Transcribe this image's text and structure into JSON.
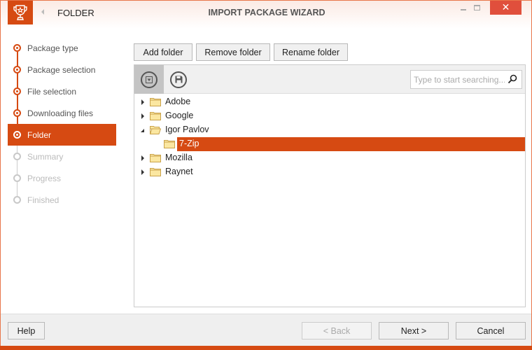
{
  "window": {
    "title": "IMPORT PACKAGE WIZARD",
    "page_title": "FOLDER",
    "accent_color": "#d64a12",
    "close_label": "✕"
  },
  "steps": [
    {
      "label": "Package type",
      "state": "done"
    },
    {
      "label": "Package selection",
      "state": "done"
    },
    {
      "label": "File selection",
      "state": "done"
    },
    {
      "label": "Downloading files",
      "state": "done"
    },
    {
      "label": "Folder",
      "state": "active"
    },
    {
      "label": "Summary",
      "state": "todo"
    },
    {
      "label": "Progress",
      "state": "todo"
    },
    {
      "label": "Finished",
      "state": "todo"
    }
  ],
  "actions": {
    "add_folder": "Add folder",
    "remove_folder": "Remove folder",
    "rename_folder": "Rename folder"
  },
  "toolbar": {
    "filter_icon": "filter-icon",
    "save_icon": "save-icon"
  },
  "search": {
    "placeholder": "Type to start searching...",
    "value": ""
  },
  "tree": [
    {
      "label": "Adobe",
      "level": 0,
      "expanded": false,
      "selected": false
    },
    {
      "label": "Google",
      "level": 0,
      "expanded": false,
      "selected": false
    },
    {
      "label": "Igor Pavlov",
      "level": 0,
      "expanded": true,
      "selected": false
    },
    {
      "label": "7-Zip",
      "level": 1,
      "expanded": null,
      "selected": true
    },
    {
      "label": "Mozilla",
      "level": 0,
      "expanded": false,
      "selected": false
    },
    {
      "label": "Raynet",
      "level": 0,
      "expanded": false,
      "selected": false
    }
  ],
  "footer": {
    "help": "Help",
    "back": "< Back",
    "next": "Next >",
    "cancel": "Cancel"
  }
}
